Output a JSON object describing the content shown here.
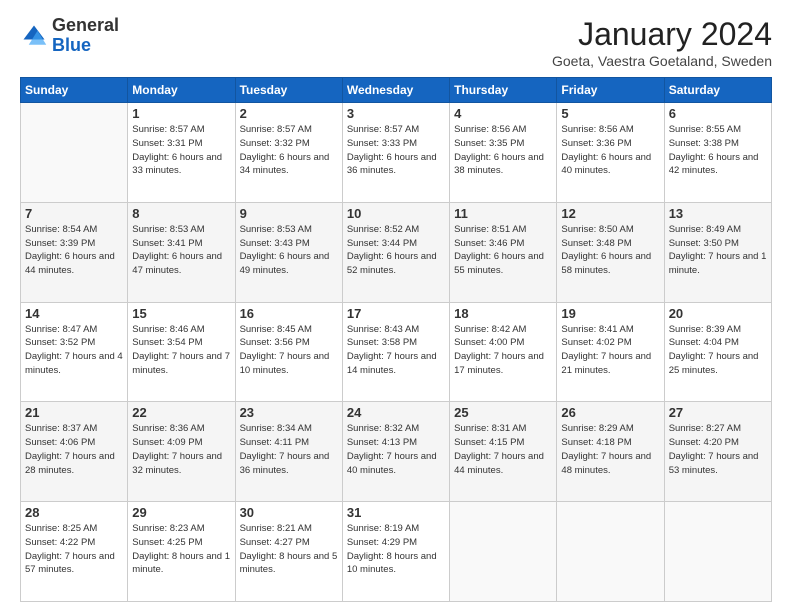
{
  "header": {
    "logo_general": "General",
    "logo_blue": "Blue",
    "title": "January 2024",
    "location": "Goeta, Vaestra Goetaland, Sweden"
  },
  "days_of_week": [
    "Sunday",
    "Monday",
    "Tuesday",
    "Wednesday",
    "Thursday",
    "Friday",
    "Saturday"
  ],
  "weeks": [
    [
      {
        "day": "",
        "sunrise": "",
        "sunset": "",
        "daylight": ""
      },
      {
        "day": "1",
        "sunrise": "Sunrise: 8:57 AM",
        "sunset": "Sunset: 3:31 PM",
        "daylight": "Daylight: 6 hours and 33 minutes."
      },
      {
        "day": "2",
        "sunrise": "Sunrise: 8:57 AM",
        "sunset": "Sunset: 3:32 PM",
        "daylight": "Daylight: 6 hours and 34 minutes."
      },
      {
        "day": "3",
        "sunrise": "Sunrise: 8:57 AM",
        "sunset": "Sunset: 3:33 PM",
        "daylight": "Daylight: 6 hours and 36 minutes."
      },
      {
        "day": "4",
        "sunrise": "Sunrise: 8:56 AM",
        "sunset": "Sunset: 3:35 PM",
        "daylight": "Daylight: 6 hours and 38 minutes."
      },
      {
        "day": "5",
        "sunrise": "Sunrise: 8:56 AM",
        "sunset": "Sunset: 3:36 PM",
        "daylight": "Daylight: 6 hours and 40 minutes."
      },
      {
        "day": "6",
        "sunrise": "Sunrise: 8:55 AM",
        "sunset": "Sunset: 3:38 PM",
        "daylight": "Daylight: 6 hours and 42 minutes."
      }
    ],
    [
      {
        "day": "7",
        "sunrise": "Sunrise: 8:54 AM",
        "sunset": "Sunset: 3:39 PM",
        "daylight": "Daylight: 6 hours and 44 minutes."
      },
      {
        "day": "8",
        "sunrise": "Sunrise: 8:53 AM",
        "sunset": "Sunset: 3:41 PM",
        "daylight": "Daylight: 6 hours and 47 minutes."
      },
      {
        "day": "9",
        "sunrise": "Sunrise: 8:53 AM",
        "sunset": "Sunset: 3:43 PM",
        "daylight": "Daylight: 6 hours and 49 minutes."
      },
      {
        "day": "10",
        "sunrise": "Sunrise: 8:52 AM",
        "sunset": "Sunset: 3:44 PM",
        "daylight": "Daylight: 6 hours and 52 minutes."
      },
      {
        "day": "11",
        "sunrise": "Sunrise: 8:51 AM",
        "sunset": "Sunset: 3:46 PM",
        "daylight": "Daylight: 6 hours and 55 minutes."
      },
      {
        "day": "12",
        "sunrise": "Sunrise: 8:50 AM",
        "sunset": "Sunset: 3:48 PM",
        "daylight": "Daylight: 6 hours and 58 minutes."
      },
      {
        "day": "13",
        "sunrise": "Sunrise: 8:49 AM",
        "sunset": "Sunset: 3:50 PM",
        "daylight": "Daylight: 7 hours and 1 minute."
      }
    ],
    [
      {
        "day": "14",
        "sunrise": "Sunrise: 8:47 AM",
        "sunset": "Sunset: 3:52 PM",
        "daylight": "Daylight: 7 hours and 4 minutes."
      },
      {
        "day": "15",
        "sunrise": "Sunrise: 8:46 AM",
        "sunset": "Sunset: 3:54 PM",
        "daylight": "Daylight: 7 hours and 7 minutes."
      },
      {
        "day": "16",
        "sunrise": "Sunrise: 8:45 AM",
        "sunset": "Sunset: 3:56 PM",
        "daylight": "Daylight: 7 hours and 10 minutes."
      },
      {
        "day": "17",
        "sunrise": "Sunrise: 8:43 AM",
        "sunset": "Sunset: 3:58 PM",
        "daylight": "Daylight: 7 hours and 14 minutes."
      },
      {
        "day": "18",
        "sunrise": "Sunrise: 8:42 AM",
        "sunset": "Sunset: 4:00 PM",
        "daylight": "Daylight: 7 hours and 17 minutes."
      },
      {
        "day": "19",
        "sunrise": "Sunrise: 8:41 AM",
        "sunset": "Sunset: 4:02 PM",
        "daylight": "Daylight: 7 hours and 21 minutes."
      },
      {
        "day": "20",
        "sunrise": "Sunrise: 8:39 AM",
        "sunset": "Sunset: 4:04 PM",
        "daylight": "Daylight: 7 hours and 25 minutes."
      }
    ],
    [
      {
        "day": "21",
        "sunrise": "Sunrise: 8:37 AM",
        "sunset": "Sunset: 4:06 PM",
        "daylight": "Daylight: 7 hours and 28 minutes."
      },
      {
        "day": "22",
        "sunrise": "Sunrise: 8:36 AM",
        "sunset": "Sunset: 4:09 PM",
        "daylight": "Daylight: 7 hours and 32 minutes."
      },
      {
        "day": "23",
        "sunrise": "Sunrise: 8:34 AM",
        "sunset": "Sunset: 4:11 PM",
        "daylight": "Daylight: 7 hours and 36 minutes."
      },
      {
        "day": "24",
        "sunrise": "Sunrise: 8:32 AM",
        "sunset": "Sunset: 4:13 PM",
        "daylight": "Daylight: 7 hours and 40 minutes."
      },
      {
        "day": "25",
        "sunrise": "Sunrise: 8:31 AM",
        "sunset": "Sunset: 4:15 PM",
        "daylight": "Daylight: 7 hours and 44 minutes."
      },
      {
        "day": "26",
        "sunrise": "Sunrise: 8:29 AM",
        "sunset": "Sunset: 4:18 PM",
        "daylight": "Daylight: 7 hours and 48 minutes."
      },
      {
        "day": "27",
        "sunrise": "Sunrise: 8:27 AM",
        "sunset": "Sunset: 4:20 PM",
        "daylight": "Daylight: 7 hours and 53 minutes."
      }
    ],
    [
      {
        "day": "28",
        "sunrise": "Sunrise: 8:25 AM",
        "sunset": "Sunset: 4:22 PM",
        "daylight": "Daylight: 7 hours and 57 minutes."
      },
      {
        "day": "29",
        "sunrise": "Sunrise: 8:23 AM",
        "sunset": "Sunset: 4:25 PM",
        "daylight": "Daylight: 8 hours and 1 minute."
      },
      {
        "day": "30",
        "sunrise": "Sunrise: 8:21 AM",
        "sunset": "Sunset: 4:27 PM",
        "daylight": "Daylight: 8 hours and 5 minutes."
      },
      {
        "day": "31",
        "sunrise": "Sunrise: 8:19 AM",
        "sunset": "Sunset: 4:29 PM",
        "daylight": "Daylight: 8 hours and 10 minutes."
      },
      {
        "day": "",
        "sunrise": "",
        "sunset": "",
        "daylight": ""
      },
      {
        "day": "",
        "sunrise": "",
        "sunset": "",
        "daylight": ""
      },
      {
        "day": "",
        "sunrise": "",
        "sunset": "",
        "daylight": ""
      }
    ]
  ]
}
